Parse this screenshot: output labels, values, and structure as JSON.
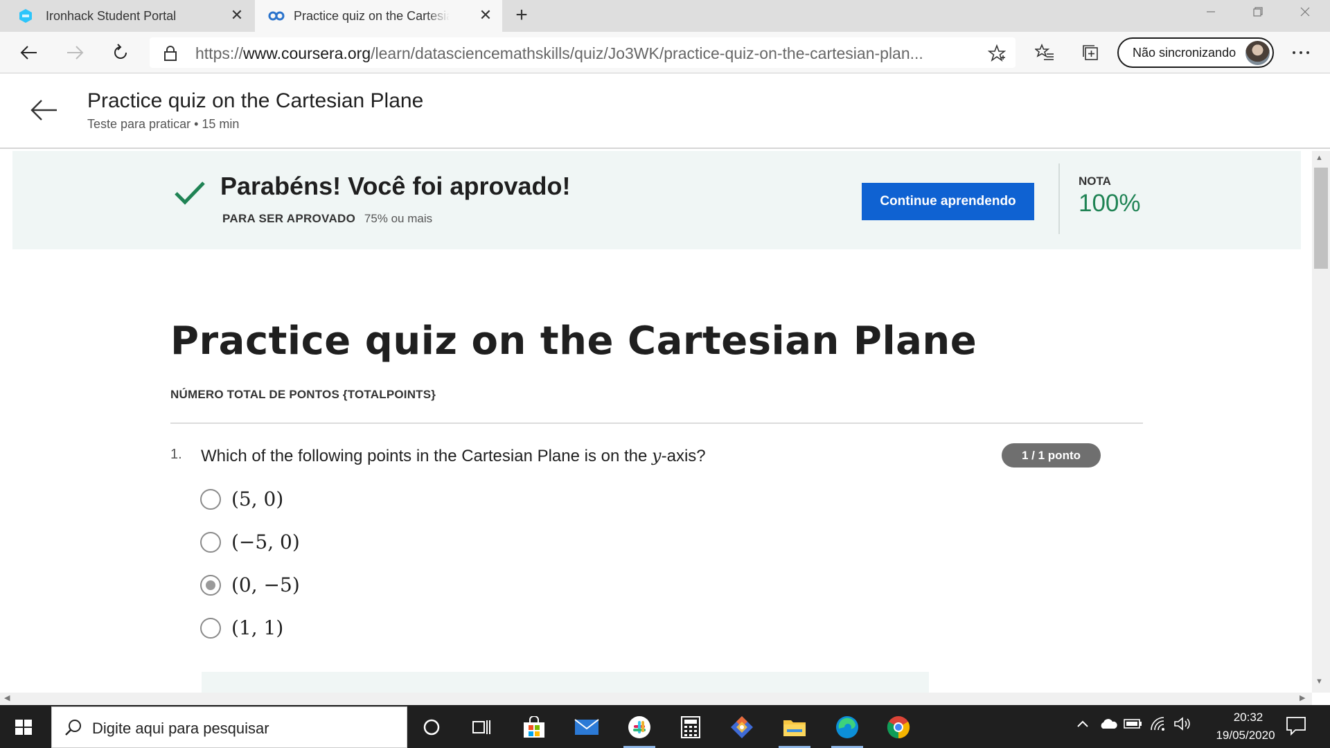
{
  "browser": {
    "tabs": [
      {
        "title": "Ironhack Student Portal",
        "active": false
      },
      {
        "title": "Practice quiz on the Cartesian Plane",
        "active": true
      }
    ],
    "url": {
      "scheme": "https://",
      "host": "www.coursera.org",
      "path": "/learn/datasciencemathskills/quiz/Jo3WK/practice-quiz-on-the-cartesian-plan..."
    },
    "profile_label": "Não sincronizando"
  },
  "page_header": {
    "title": "Practice quiz on the Cartesian Plane",
    "subtitle": "Teste para praticar • 15 min"
  },
  "banner": {
    "title": "Parabéns! Você foi aprovado!",
    "pass_label": "PARA SER APROVADO",
    "pass_value": "75% ou mais",
    "continue_label": "Continue aprendendo",
    "grade_label": "NOTA",
    "grade_value": "100%",
    "grade_color": "#1f8354",
    "button_color": "#0f62d2"
  },
  "quiz": {
    "title": "Practice quiz on the Cartesian Plane",
    "total_points": "NÚMERO TOTAL DE PONTOS {TOTALPOINTS}",
    "questions": [
      {
        "number": "1.",
        "text_before": "Which of the following points in the Cartesian Plane is on the ",
        "text_math": "y",
        "text_after": "-axis?",
        "points": "1 / 1 ponto",
        "options": [
          {
            "label": "(5, 0)",
            "selected": false
          },
          {
            "label": "(−5, 0)",
            "selected": false
          },
          {
            "label": "(0, −5)",
            "selected": true
          },
          {
            "label": "(1, 1)",
            "selected": false
          }
        ]
      }
    ]
  },
  "taskbar": {
    "search_placeholder": "Digite aqui para pesquisar",
    "apps": [
      "cortana-icon",
      "task-view-icon",
      "store-icon",
      "mail-icon",
      "slack-icon",
      "calculator-icon",
      "git-icon",
      "file-explorer-icon",
      "edge-icon",
      "chrome-icon"
    ],
    "time": "20:32",
    "date": "19/05/2020"
  }
}
